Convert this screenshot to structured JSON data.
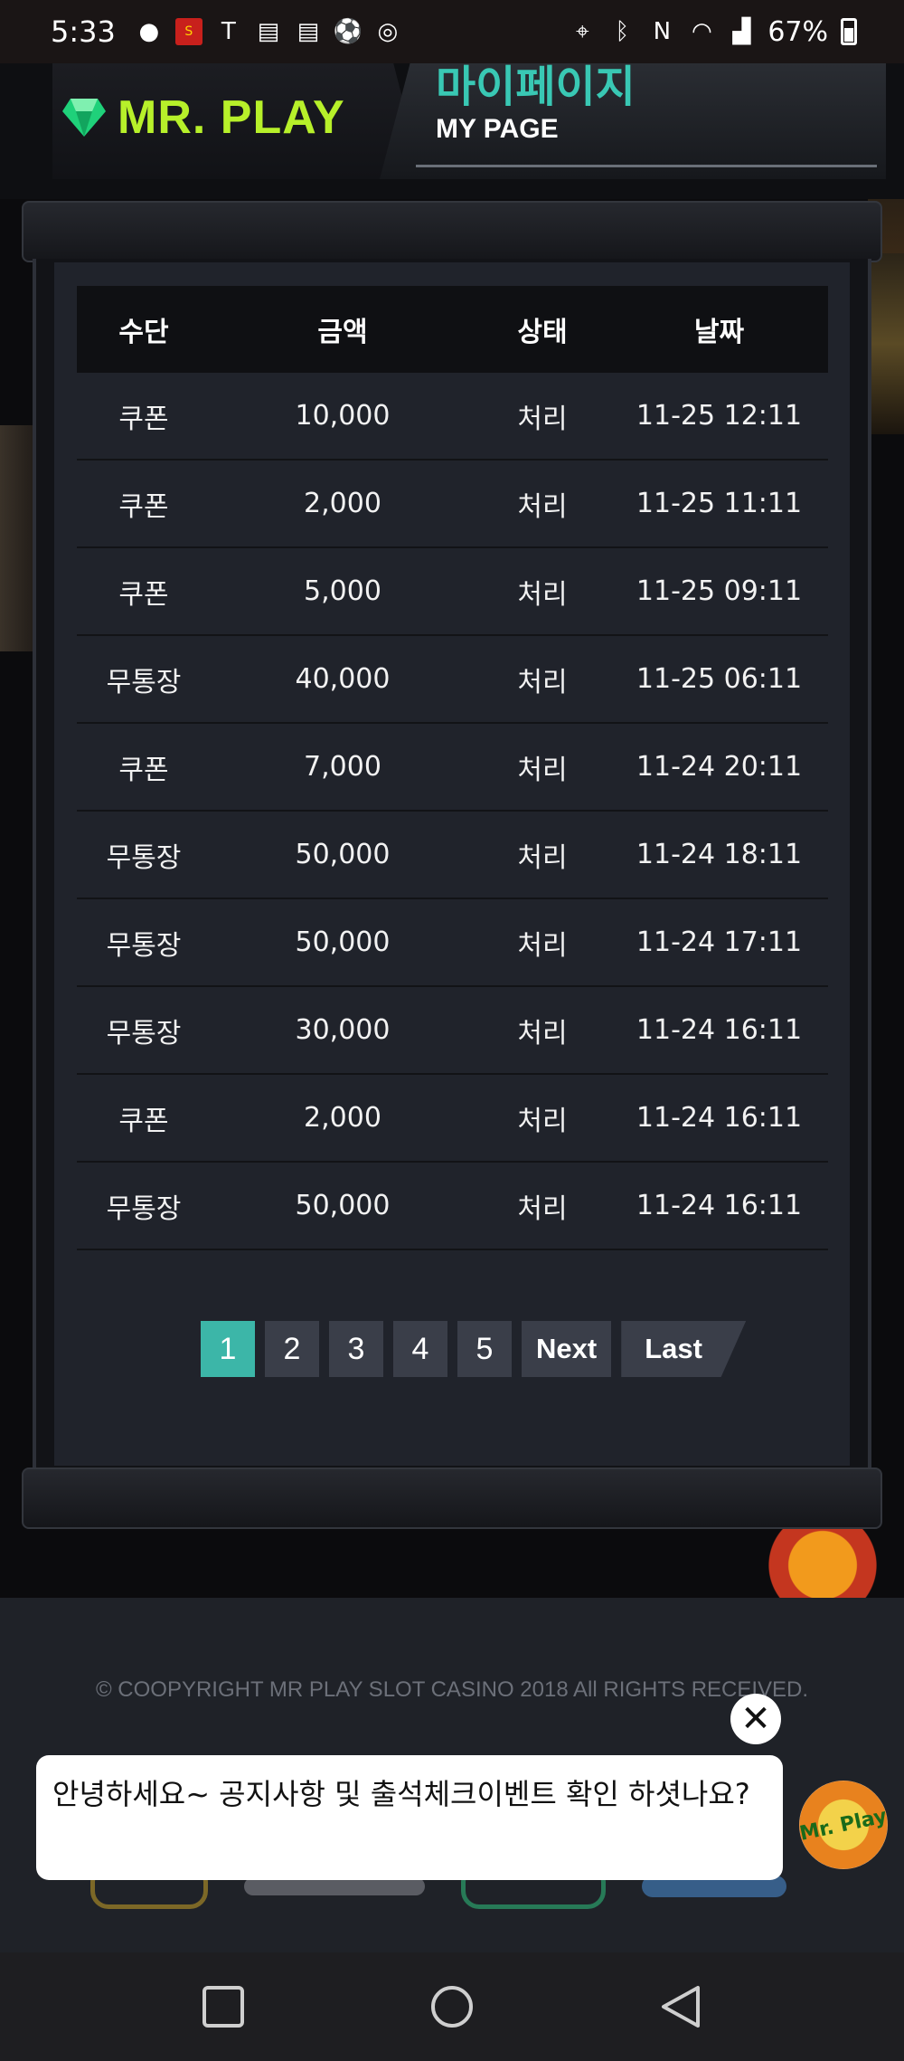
{
  "status_bar": {
    "time": "5:33",
    "battery": "67%",
    "left_icons": [
      "notification-icon",
      "call-maker-icon",
      "t-icon",
      "calendar-icon",
      "calendar-icon",
      "soccer-icon",
      "steering-icon"
    ],
    "right_icons": [
      "location-icon",
      "bluetooth-icon",
      "nfc-icon",
      "wifi-icon",
      "signal-icon"
    ]
  },
  "header": {
    "logo": "MR. PLAY",
    "title_kr": "마이페이지",
    "title_en": "MY PAGE"
  },
  "table": {
    "columns": [
      "수단",
      "금액",
      "상태",
      "날짜"
    ],
    "rows": [
      {
        "method": "쿠폰",
        "amount": "10,000",
        "status": "처리",
        "date": "11-25 12:11"
      },
      {
        "method": "쿠폰",
        "amount": "2,000",
        "status": "처리",
        "date": "11-25 11:11"
      },
      {
        "method": "쿠폰",
        "amount": "5,000",
        "status": "처리",
        "date": "11-25 09:11"
      },
      {
        "method": "무통장",
        "amount": "40,000",
        "status": "처리",
        "date": "11-25 06:11"
      },
      {
        "method": "쿠폰",
        "amount": "7,000",
        "status": "처리",
        "date": "11-24 20:11"
      },
      {
        "method": "무통장",
        "amount": "50,000",
        "status": "처리",
        "date": "11-24 18:11"
      },
      {
        "method": "무통장",
        "amount": "50,000",
        "status": "처리",
        "date": "11-24 17:11"
      },
      {
        "method": "무통장",
        "amount": "30,000",
        "status": "처리",
        "date": "11-24 16:11"
      },
      {
        "method": "쿠폰",
        "amount": "2,000",
        "status": "처리",
        "date": "11-24 16:11"
      },
      {
        "method": "무통장",
        "amount": "50,000",
        "status": "처리",
        "date": "11-24 16:11"
      }
    ]
  },
  "pagination": {
    "pages": [
      "1",
      "2",
      "3",
      "4",
      "5"
    ],
    "active": "1",
    "next": "Next",
    "last": "Last"
  },
  "footer": {
    "copyright": "© COOPYRIGHT MR PLAY SLOT CASINO 2018 All RIGHTS RECEIVED."
  },
  "chat": {
    "message": "안녕하세요~ 공지사항 및 출석체크이벤트 확인 하셧나요?",
    "avatar_text": "Mr. Play"
  },
  "colors": {
    "accent": "#3cb6a8",
    "logo": "#b7f02a",
    "title_kr": "#39c8b4"
  }
}
